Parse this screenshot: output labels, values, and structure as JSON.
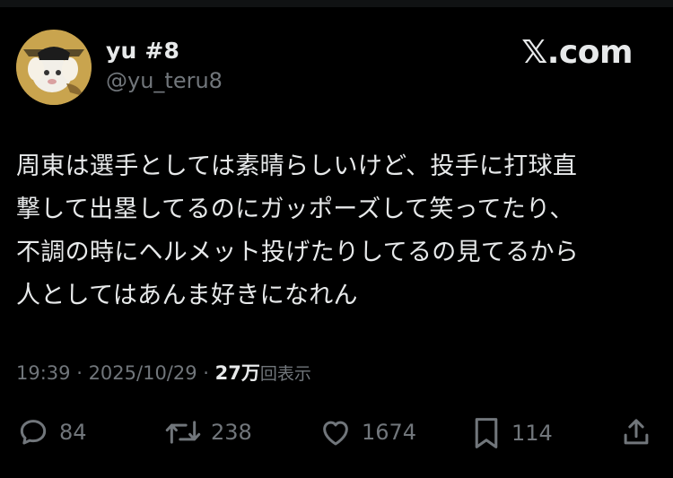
{
  "author": {
    "display_name": "yu #8",
    "handle": "@yu_teru8"
  },
  "brand": {
    "label": "𝕏.com"
  },
  "post": {
    "text": "周東は選手としては素晴らしいけど、投手に打球直\n撃して出塁してるのにガッポーズして笑ってたり、\n不調の時にヘルメット投げたりしてるの見てるから\n人としてはあんま好きになれん"
  },
  "meta": {
    "time": "19:39",
    "separator": " · ",
    "date": "2025/10/29",
    "views_count": "27万",
    "views_label": "回表示"
  },
  "actions": {
    "replies": {
      "icon": "reply-icon",
      "count": "84"
    },
    "reposts": {
      "icon": "repost-icon",
      "count": "238"
    },
    "likes": {
      "icon": "heart-icon",
      "count": "1674"
    },
    "bookmarks": {
      "icon": "bookmark-icon",
      "count": "114"
    },
    "share": {
      "icon": "share-icon"
    }
  },
  "colors": {
    "background": "#000000",
    "text_primary": "#e7e9ea",
    "text_secondary": "#71767b"
  }
}
